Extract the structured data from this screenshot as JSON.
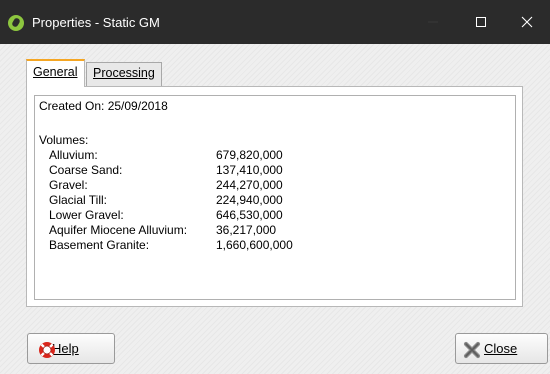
{
  "window": {
    "title": "Properties - Static GM",
    "icon": "app-logo-icon",
    "controls": [
      "minimize-icon",
      "maximize-icon",
      "close-icon"
    ]
  },
  "tabs": [
    {
      "label": "General",
      "active": true
    },
    {
      "label": "Processing",
      "active": false
    }
  ],
  "general": {
    "created_on": "Created On: 25/09/2018",
    "volumes_heading": "Volumes:",
    "volumes": [
      {
        "name": "Alluvium:",
        "value": "679,820,000"
      },
      {
        "name": "Coarse Sand:",
        "value": "137,410,000"
      },
      {
        "name": "Gravel:",
        "value": "244,270,000"
      },
      {
        "name": "Glacial Till:",
        "value": "224,940,000"
      },
      {
        "name": "Lower Gravel:",
        "value": "646,530,000"
      },
      {
        "name": "Aquifer Miocene Alluvium:",
        "value": "36,217,000"
      },
      {
        "name": "Basement Granite:",
        "value": "1,660,600,000"
      }
    ]
  },
  "buttons": {
    "help": {
      "label": "Help",
      "icon": "lifebuoy-icon"
    },
    "close": {
      "label": "Close",
      "icon": "close-x-icon"
    }
  },
  "colors": {
    "titlebar": "#2b2b2b",
    "active_tab_accent": "#f5a623",
    "app_icon": "#8dc63f",
    "help_icon": "#d9261c"
  }
}
